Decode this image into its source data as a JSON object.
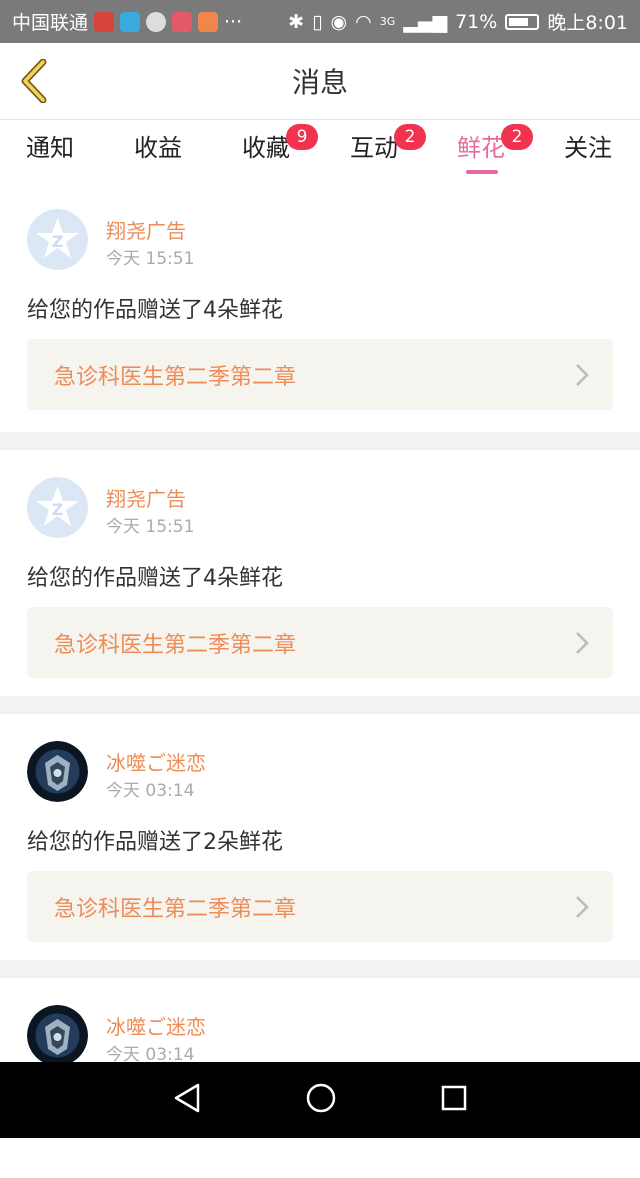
{
  "status_bar": {
    "carrier": "中国联通",
    "more": "···",
    "network": "3G",
    "battery": "71%",
    "time": "晚上8:01",
    "battery_level": 0.71
  },
  "header": {
    "title": "消息"
  },
  "tabs": [
    {
      "label": "通知",
      "badge": ""
    },
    {
      "label": "收益",
      "badge": ""
    },
    {
      "label": "收藏",
      "badge": "9"
    },
    {
      "label": "互动",
      "badge": "2"
    },
    {
      "label": "鲜花",
      "badge": "2",
      "active": true
    },
    {
      "label": "关注",
      "badge": ""
    }
  ],
  "messages": [
    {
      "user": "翔尧广告",
      "time": "今天 15:51",
      "text": "给您的作品赠送了4朵鲜花",
      "work": "急诊科医生第二季第二章",
      "avatar": "default-avatar-icon"
    },
    {
      "user": "翔尧广告",
      "time": "今天 15:51",
      "text": "给您的作品赠送了4朵鲜花",
      "work": "急诊科医生第二季第二章",
      "avatar": "default-avatar-icon"
    },
    {
      "user": "冰噬ご迷恋",
      "time": "今天 03:14",
      "text": "给您的作品赠送了2朵鲜花",
      "work": "急诊科医生第二季第二章",
      "avatar": "user-photo"
    },
    {
      "user": "冰噬ご迷恋",
      "time": "今天 03:14",
      "text": "",
      "work": "",
      "avatar": "user-photo"
    }
  ],
  "colors": {
    "accent_pink": "#e86aa0",
    "accent_orange": "#ee8c58",
    "badge_red": "#f2334f"
  }
}
